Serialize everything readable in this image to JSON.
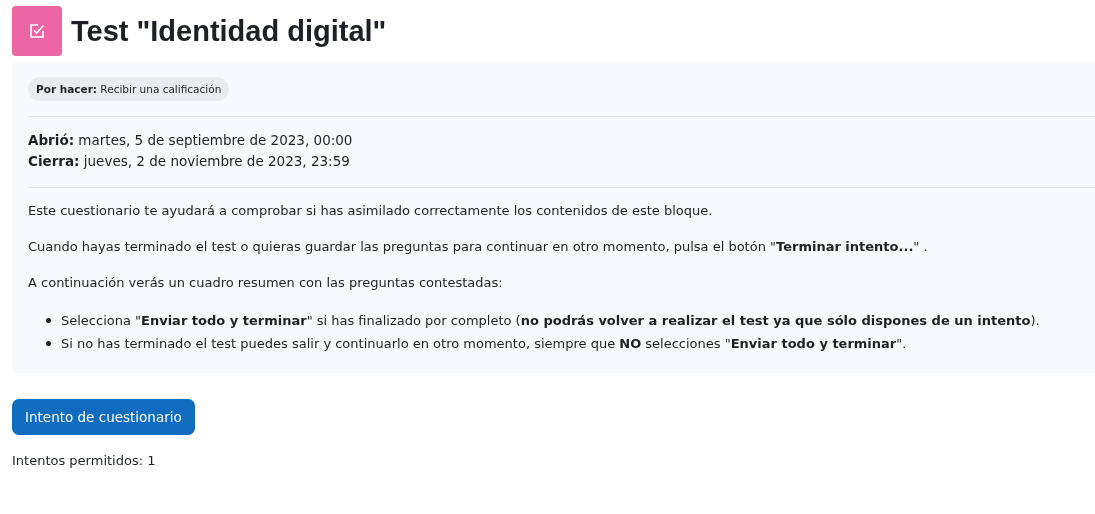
{
  "header": {
    "title": "Test \"Identidad digital\""
  },
  "completion": {
    "badge": "**Por hacer:** Recibir una calificación"
  },
  "dates": [
    "**Abrió:** martes, 5 de septiembre de 2023, 00:00",
    "**Cierra:** jueves, 2 de noviembre de 2023, 23:59"
  ],
  "intro": {
    "paragraphs": [
      "Este cuestionario te ayudará a comprobar si has asimilado correctamente los contenidos de este bloque.",
      "Cuando hayas terminado el test o quieras guardar las preguntas para continuar en otro momento, pulsa el botón \"**Terminar intento...**\" .",
      "A continuación verás un cuadro resumen con las preguntas contestadas:"
    ],
    "bullets": [
      "Selecciona \"**Enviar todo y terminar**\" si has finalizado por completo (**no podrás volver a realizar el test ya que sólo dispones de un intento**).",
      "Si no has terminado el test puedes salir y continuarlo en otro momento, siempre que **NO** selecciones \"**Enviar todo y terminar**\"."
    ]
  },
  "attempt_button": "Intento de cuestionario",
  "attempts_allowed": "Intentos permitidos: 1"
}
